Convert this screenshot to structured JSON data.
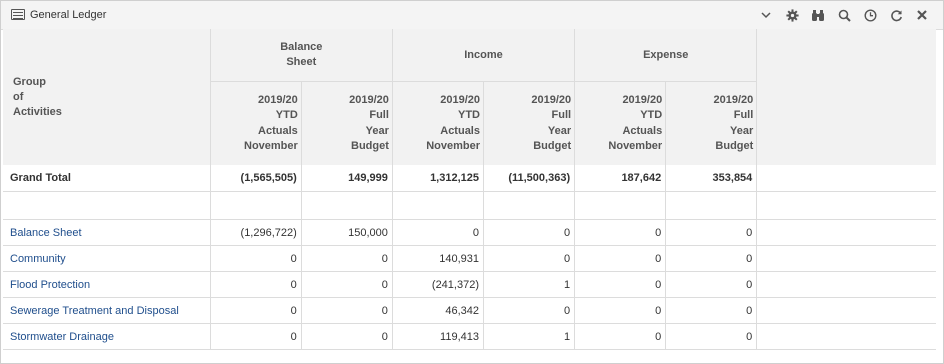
{
  "window": {
    "title": "General Ledger"
  },
  "toolbar": [
    {
      "icon": "chevron-down-icon"
    },
    {
      "icon": "gear-icon"
    },
    {
      "icon": "binoculars-icon"
    },
    {
      "icon": "search-icon"
    },
    {
      "icon": "clock-icon"
    },
    {
      "icon": "refresh-icon"
    },
    {
      "icon": "close-icon"
    }
  ],
  "table": {
    "row_header_label": "Group\nof\nActivities",
    "groups": [
      "Balance\nSheet",
      "Income",
      "Expense"
    ],
    "subcolumns": [
      "2019/20\nYTD\nActuals\nNovember",
      "2019/20\nFull\nYear\nBudget",
      "2019/20\nYTD\nActuals\nNovember",
      "2019/20\nFull\nYear\nBudget",
      "2019/20\nYTD\nActuals\nNovember",
      "2019/20\nFull\nYear\nBudget"
    ],
    "grand_total": {
      "label": "Grand Total",
      "values": [
        "(1,565,505)",
        "149,999",
        "1,312,125",
        "(11,500,363)",
        "187,642",
        "353,854"
      ]
    },
    "rows": [
      {
        "label": "Balance Sheet",
        "values": [
          "(1,296,722)",
          "150,000",
          "0",
          "0",
          "0",
          "0"
        ]
      },
      {
        "label": "Community",
        "values": [
          "0",
          "0",
          "140,931",
          "0",
          "0",
          "0"
        ]
      },
      {
        "label": "Flood Protection",
        "values": [
          "0",
          "0",
          "(241,372)",
          "1",
          "0",
          "0"
        ]
      },
      {
        "label": "Sewerage Treatment and Disposal",
        "values": [
          "0",
          "0",
          "46,342",
          "0",
          "0",
          "0"
        ]
      },
      {
        "label": "Stormwater Drainage",
        "values": [
          "0",
          "0",
          "119,413",
          "1",
          "0",
          "0"
        ]
      }
    ]
  }
}
